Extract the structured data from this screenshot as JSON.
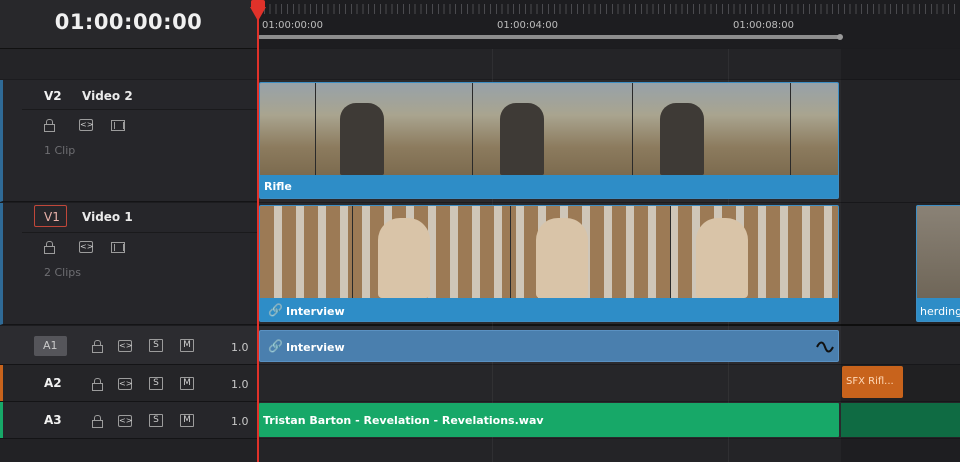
{
  "timecode": "01:00:00:00",
  "ruler": {
    "labels": [
      "01:00:00:00",
      "01:00:04:00",
      "01:00:08:00"
    ]
  },
  "tracks": {
    "v2": {
      "id": "V2",
      "name": "Video 2",
      "clip_count": "1 Clip"
    },
    "v1": {
      "id": "V1",
      "name": "Video 1",
      "clip_count": "2 Clips"
    },
    "a1": {
      "id": "A1",
      "volume": "1.0"
    },
    "a2": {
      "id": "A2",
      "volume": "1.0"
    },
    "a3": {
      "id": "A3",
      "volume": "1.0"
    }
  },
  "buttons": {
    "solo": "S",
    "mute": "M",
    "auto_select": "<>"
  },
  "clips": {
    "rifle": "Rifle",
    "interview_video": "Interview",
    "herding": "herding",
    "interview_audio": "Interview",
    "sfx": "SFX Rifl...",
    "music": "Tristan Barton - Revelation - Revelations.wav"
  },
  "colors": {
    "video_clip": "#2e8dc7",
    "audio_clip": "#4a7fae",
    "music_clip": "#17a868",
    "sfx_clip": "#c8631c",
    "playhead": "#e0322a"
  }
}
